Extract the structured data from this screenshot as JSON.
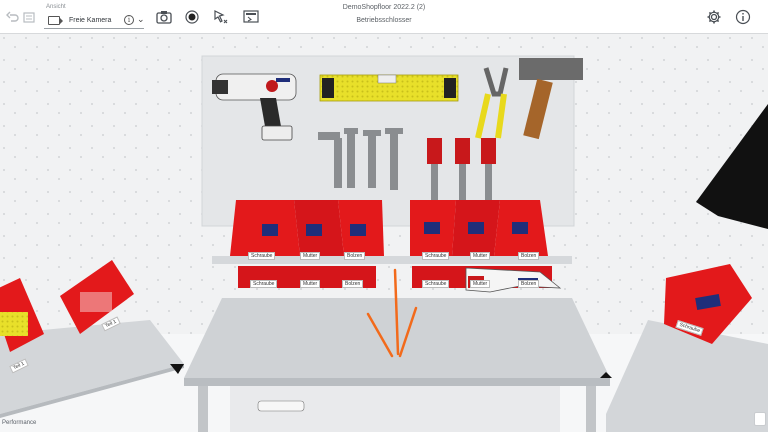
{
  "toolbar": {
    "view_caption": "Ansicht",
    "view_value": "Freie Kamera",
    "title": "DemoShopfloor 2022.2 (2)",
    "subtitle": "Betriebsschlosser"
  },
  "icons": {
    "undo": "undo-icon",
    "redo": "redo-icon",
    "camera": "camera-icon",
    "record": "record-icon",
    "cursor": "pointer-icon",
    "present": "presentation-icon",
    "settings": "gear-icon",
    "info": "info-icon"
  },
  "bins": {
    "upper_left": [
      "Schraube",
      "Mutter",
      "Bolzen"
    ],
    "upper_right": [
      "Schraube",
      "Mutter",
      "Bolzen"
    ],
    "lower_left": [
      "Schraube",
      "Mutter",
      "Bolzen"
    ],
    "lower_right": [
      "Schraube",
      "Mutter",
      "Bolzen"
    ],
    "side_left": "Teil 1",
    "side_left_far": "Teil 1",
    "side_right": "Schraube"
  },
  "footer": {
    "performance": "Performance"
  },
  "colors": {
    "bin_red": "#e3191b",
    "bin_dark_red": "#b31114",
    "panel": "#e9ebed",
    "part_blue": "#1f2e7a",
    "level_yellow": "#e8e02a",
    "arrow_orange": "#f26a1b"
  }
}
